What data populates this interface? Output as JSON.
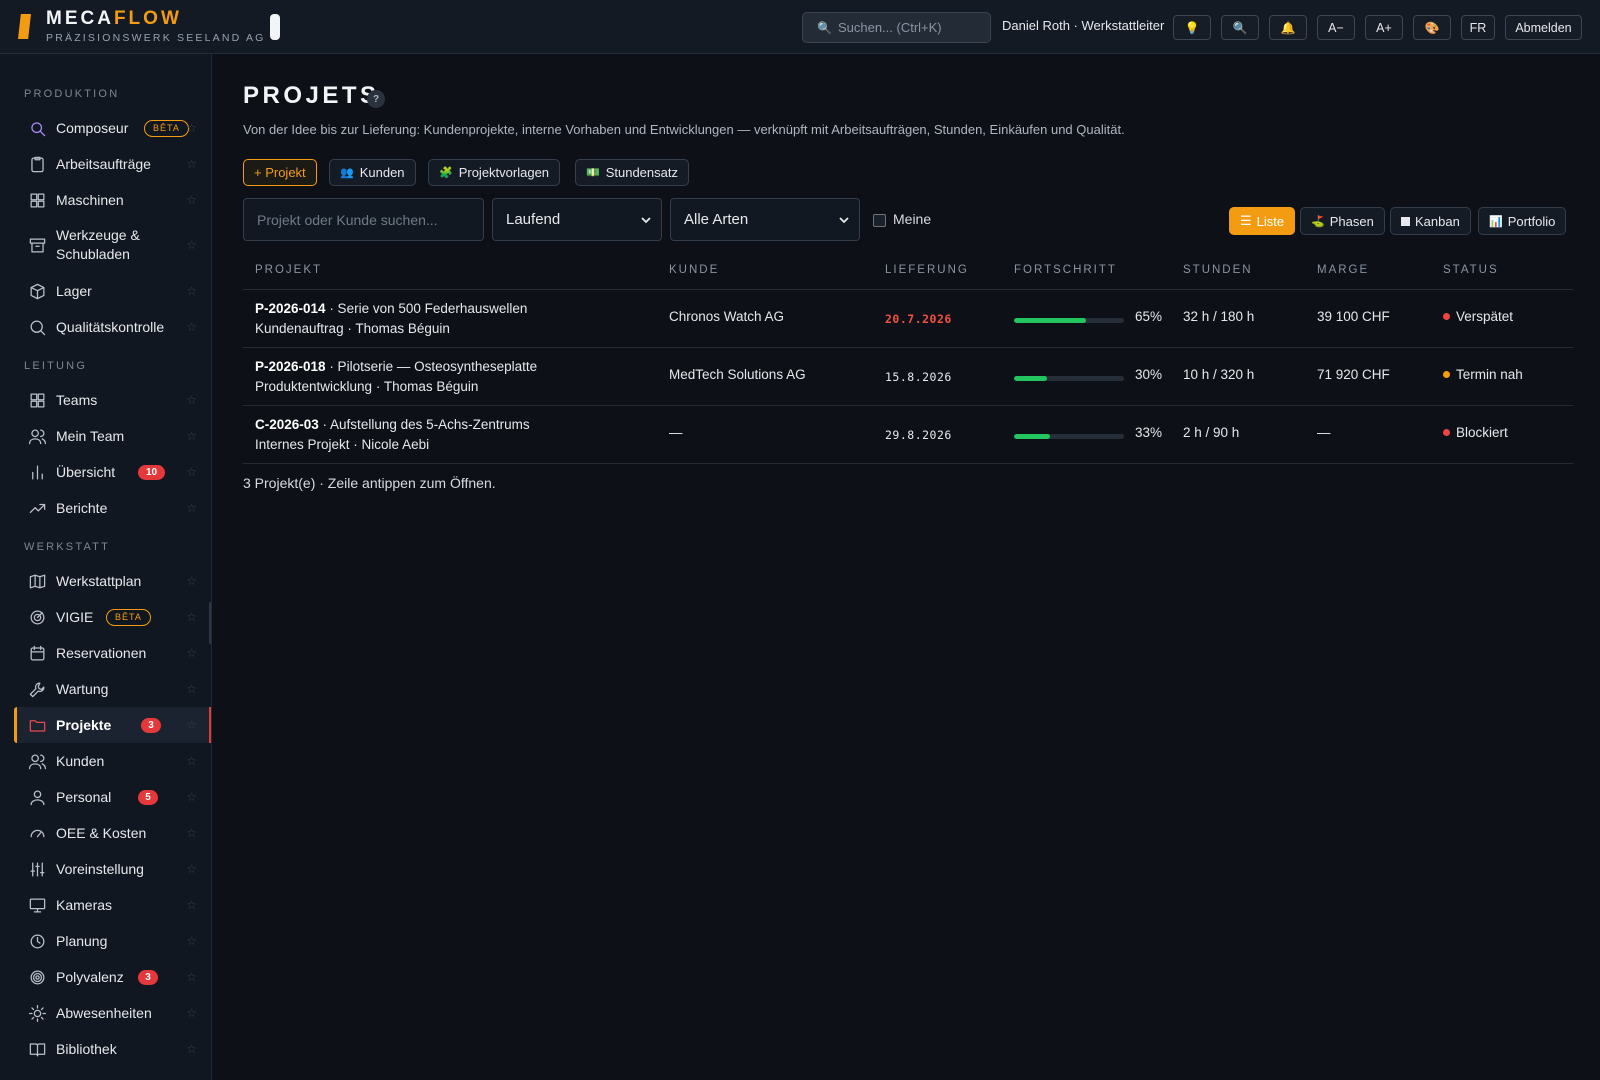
{
  "brand": {
    "name_a": "MECA",
    "name_b": "FLOW",
    "subtitle": "PRÄZISIONSWERK SEELAND AG"
  },
  "header": {
    "search_placeholder": "Suchen...  (Ctrl+K)",
    "user": "Daniel Roth · Werkstattleiter",
    "btn_font_minus": "A−",
    "btn_font_plus": "A+",
    "btn_lang": "FR",
    "btn_logout": "Abmelden"
  },
  "sidebar": {
    "section_produktion": "PRODUKTION",
    "section_leitung": "LEITUNG",
    "section_werkstatt": "WERKSTATT",
    "items": [
      {
        "label": "Composeur",
        "beta": "BÊTA"
      },
      {
        "label": "Arbeitsaufträge"
      },
      {
        "label": "Maschinen"
      },
      {
        "label": "Werkzeuge & Schubladen"
      },
      {
        "label": "Lager"
      },
      {
        "label": "Qualitätskontrolle"
      },
      {
        "label": "Teams"
      },
      {
        "label": "Mein Team"
      },
      {
        "label": "Übersicht",
        "badge": "10"
      },
      {
        "label": "Berichte"
      },
      {
        "label": "Werkstattplan"
      },
      {
        "label": "VIGIE",
        "beta": "BÊTA"
      },
      {
        "label": "Reservationen"
      },
      {
        "label": "Wartung"
      },
      {
        "label": "Projekte",
        "badge": "3"
      },
      {
        "label": "Kunden"
      },
      {
        "label": "Personal",
        "badge": "5"
      },
      {
        "label": "OEE & Kosten"
      },
      {
        "label": "Voreinstellung"
      },
      {
        "label": "Kameras"
      },
      {
        "label": "Planung"
      },
      {
        "label": "Polyvalenz",
        "badge": "3"
      },
      {
        "label": "Abwesenheiten"
      },
      {
        "label": "Bibliothek"
      }
    ]
  },
  "main": {
    "title": "PROJETS",
    "help": "?",
    "subtitle": "Von der Idee bis zur Lieferung: Kundenprojekte, interne Vorhaben und Entwicklungen — verknüpft mit Arbeitsaufträgen, Stunden, Einkäufen und Qualität.",
    "actions": {
      "new_project": "+ Projekt",
      "customers": "Kunden",
      "templates": "Projektvorlagen",
      "rate": "Stundensatz"
    },
    "filters": {
      "search_placeholder": "Projekt oder Kunde suchen...",
      "status": "Laufend",
      "type": "Alle Arten",
      "mine": "Meine"
    },
    "views": {
      "list": "Liste",
      "phases": "Phasen",
      "kanban": "Kanban",
      "portfolio": "Portfolio"
    },
    "columns": {
      "project": "PROJEKT",
      "customer": "KUNDE",
      "delivery": "LIEFERUNG",
      "progress": "FORTSCHRITT",
      "hours": "STUNDEN",
      "margin": "MARGE",
      "status": "STATUS"
    },
    "rows": [
      {
        "id": "P-2026-014",
        "name": " · Serie von 500 Federhauswellen",
        "meta": "Kundenauftrag · Thomas Béguin",
        "customer": "Chronos Watch AG",
        "delivery": "20.7.2026",
        "late": true,
        "progress": 65,
        "progress_label": "65%",
        "hours": "32 h / 180 h",
        "margin": "39 100 CHF",
        "status": "Verspätet",
        "status_color": "#ef4444"
      },
      {
        "id": "P-2026-018",
        "name": " · Pilotserie — Osteosyntheseplatte",
        "meta": "Produktentwicklung · Thomas Béguin",
        "customer": "MedTech Solutions AG",
        "delivery": "15.8.2026",
        "late": false,
        "progress": 30,
        "progress_label": "30%",
        "hours": "10 h / 320 h",
        "margin": "71 920 CHF",
        "status": "Termin nah",
        "status_color": "#f59e0b"
      },
      {
        "id": "C-2026-03",
        "name": " · Aufstellung des 5-Achs-Zentrums",
        "meta": "Internes Projekt · Nicole Aebi",
        "customer": "—",
        "delivery": "29.8.2026",
        "late": false,
        "progress": 33,
        "progress_label": "33%",
        "hours": "2 h / 90 h",
        "margin": "—",
        "status": "Blockiert",
        "status_color": "#ef4444"
      }
    ],
    "footer": "3 Projekt(e) · Zeile antippen zum Öffnen."
  },
  "colors": {
    "accent": "#f39c12",
    "danger": "#e5383b",
    "success": "#22c55e",
    "warning": "#f59e0b"
  }
}
